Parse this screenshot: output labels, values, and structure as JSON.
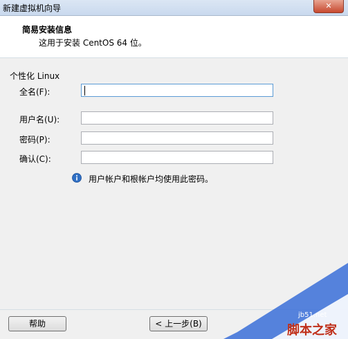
{
  "window": {
    "title": "新建虚拟机向导",
    "close_label": "✕"
  },
  "header": {
    "title": "简易安装信息",
    "subtitle": "这用于安装 CentOS 64 位。"
  },
  "personalize": {
    "section_label": "个性化 Linux"
  },
  "fields": {
    "fullname": {
      "label": "全名(F):",
      "value": ""
    },
    "username": {
      "label": "用户名(U):",
      "value": ""
    },
    "password": {
      "label": "密码(P):",
      "value": ""
    },
    "confirm": {
      "label": "确认(C):",
      "value": ""
    }
  },
  "info": {
    "text": "用户帐户和根帐户均使用此密码。",
    "icon": "info-icon"
  },
  "buttons": {
    "help": "帮助",
    "back": "< 上一步(B)"
  },
  "watermark": {
    "text": "脚本之家",
    "url": "jb51.net"
  }
}
